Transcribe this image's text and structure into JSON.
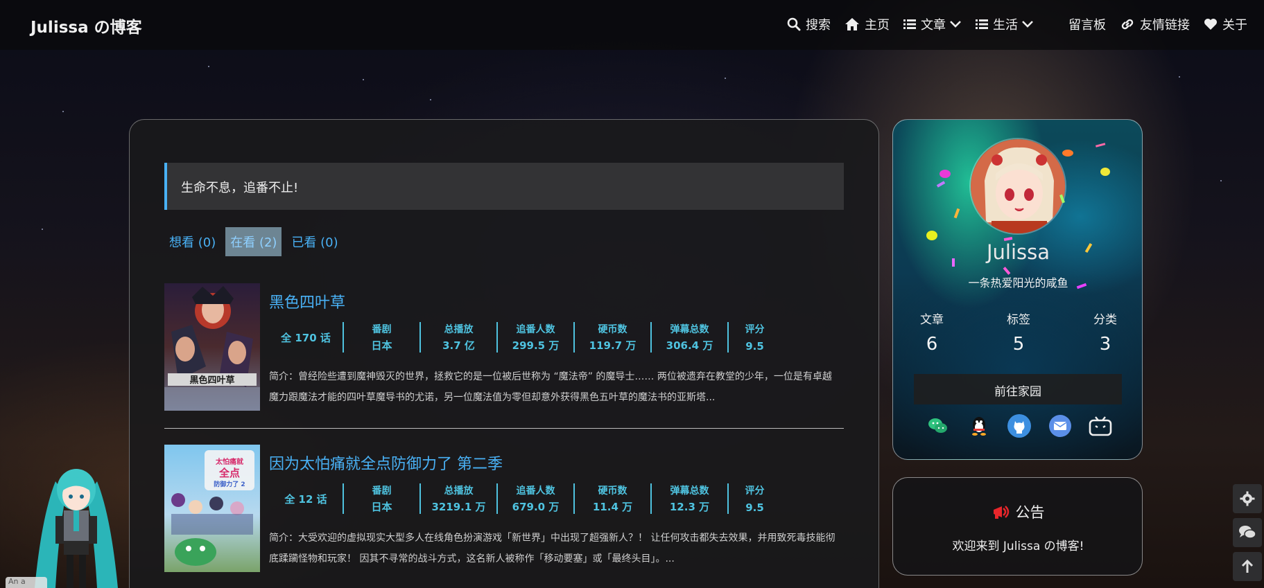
{
  "brand": "Julissa の博客",
  "nav": {
    "search": "搜索",
    "home": "主页",
    "articles": "文章",
    "life": "生活",
    "guestbook": "留言板",
    "links": "友情链接",
    "about": "关于"
  },
  "motto": "生命不息，追番不止!",
  "tabs": [
    {
      "label": "想看 (0)",
      "active": false
    },
    {
      "label": "在看 (2)",
      "active": true
    },
    {
      "label": "已看 (0)",
      "active": false
    }
  ],
  "stat_labels": {
    "type": "番剧",
    "plays": "总播放",
    "followers": "追番人数",
    "coins": "硬币数",
    "danmaku": "弹幕总数",
    "score": "评分"
  },
  "anime": [
    {
      "title": "黑色四叶草",
      "total": "全 170 话",
      "region": "日本",
      "plays": "3.7 亿",
      "followers": "299.5 万",
      "coins": "119.7 万",
      "danmaku": "306.4 万",
      "score": "9.5",
      "summary": "简介：曾经险些遭到魔神毁灭的世界，拯救它的是一位被后世称为 “魔法帝” 的魔导士…… 两位被遗弃在教堂的少年，一位是有卓越魔力跟魔法才能的四叶草魔导书的尤诺，另一位魔法值为零但却意外获得黑色五叶草的魔法书的亚斯塔..."
    },
    {
      "title": "因为太怕痛就全点防御力了 第二季",
      "total": "全 12 话",
      "region": "日本",
      "plays": "3219.1 万",
      "followers": "679.0 万",
      "coins": "11.4 万",
      "danmaku": "12.3 万",
      "score": "9.5",
      "summary": "简介：大受欢迎的虚拟现实大型多人在线角色扮演游戏「新世界」中出现了超强新人？！ 让任何攻击都失去效果，并用致死毒技能彻底蹂躏怪物和玩家！ 因其不寻常的战斗方式，这名新人被称作「移动要塞」或「最终头目」。..."
    }
  ],
  "profile": {
    "name": "Julissa",
    "bio": "一条热爱阳光的咸鱼",
    "counts": [
      {
        "label": "文章",
        "value": "6"
      },
      {
        "label": "标签",
        "value": "5"
      },
      {
        "label": "分类",
        "value": "3"
      }
    ],
    "home_button": "前往家园"
  },
  "notice": {
    "title": "公告",
    "text": "欢迎来到 Julissa の博客!"
  },
  "mascot_tip": "An a"
}
